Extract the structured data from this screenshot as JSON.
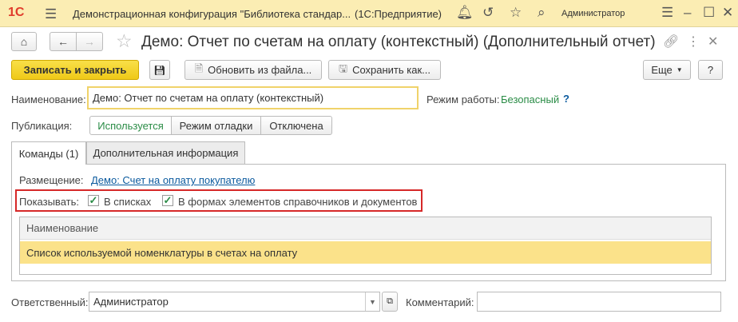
{
  "titlebar": {
    "logo": "1С",
    "title": "Демонстрационная конфигурация \"Библиотека стандар...",
    "platform": "(1С:Предприятие)",
    "user": "Администратор"
  },
  "form": {
    "title": "Демо: Отчет по счетам на оплату (контекстный) (Дополнительный отчет)"
  },
  "commandbar": {
    "save_close": "Записать и закрыть",
    "update_from_file": "Обновить из файла...",
    "save_as": "Сохранить как...",
    "more": "Еще",
    "help": "?"
  },
  "name_field": {
    "label": "Наименование:",
    "value": "Демо: Отчет по счетам на оплату (контекстный)"
  },
  "mode": {
    "label": "Режим работы:",
    "value": "Безопасный",
    "help": "?"
  },
  "publication": {
    "label": "Публикация:",
    "options": [
      "Используется",
      "Режим отладки",
      "Отключена"
    ],
    "selected": "Используется"
  },
  "tabs": [
    {
      "label": "Команды (1)",
      "active": true
    },
    {
      "label": "Дополнительная информация",
      "active": false
    }
  ],
  "placement": {
    "label": "Размещение:",
    "link": "Демо: Счет на оплату покупателю"
  },
  "show": {
    "label": "Показывать:",
    "in_lists": "В списках",
    "in_lists_checked": true,
    "in_forms": "В формах элементов справочников и документов",
    "in_forms_checked": true
  },
  "table": {
    "header": "Наименование",
    "rows": [
      "Список используемой номенклатуры в счетах на оплату"
    ]
  },
  "responsible": {
    "label": "Ответственный:",
    "value": "Администратор"
  },
  "comment": {
    "label": "Комментарий:",
    "value": ""
  },
  "colors": {
    "titlebar_bg": "#fbedb3",
    "primary_button": "#efc918",
    "selected_row": "#fbe28a",
    "accent_green": "#2a8c46",
    "highlight_red": "#d62828",
    "link": "#0b5a9e"
  }
}
